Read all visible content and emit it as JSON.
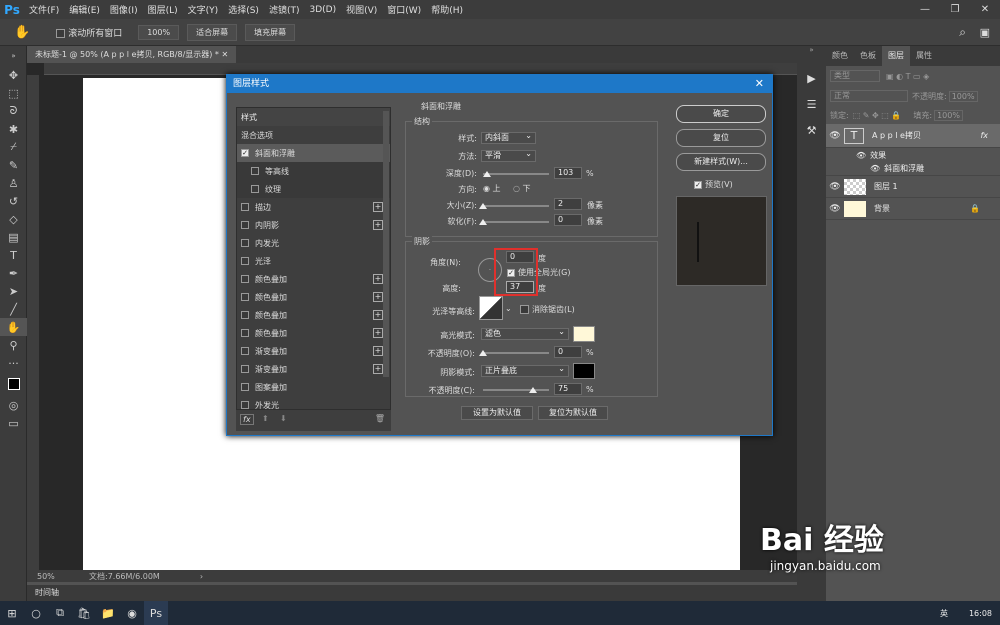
{
  "app": {
    "logo": "Ps",
    "menus": [
      "文件(F)",
      "编辑(E)",
      "图像(I)",
      "图层(L)",
      "文字(Y)",
      "选择(S)",
      "滤镜(T)",
      "3D(D)",
      "视图(V)",
      "窗口(W)",
      "帮助(H)"
    ]
  },
  "options": {
    "scroll_all": "滚动所有窗口",
    "zoom": "100%",
    "fit_screen": "适合屏幕",
    "fill_screen": "填充屏幕"
  },
  "document": {
    "tab_title": "未标题-1 @ 50% (A p p l e拷贝, RGB/8/显示器) *",
    "zoom": "50%",
    "doc_info": "文档:7.66M/6.00M",
    "timeline": "时间轴"
  },
  "layers_panel": {
    "tabs": [
      "颜色",
      "色板",
      "图层",
      "属性"
    ],
    "active_tab": "图层",
    "filter_placeholder": "类型",
    "blend_mode": "正常",
    "opacity_label": "不透明度:",
    "opacity_value": "100%",
    "lock_label": "锁定:",
    "fill_label": "填充:",
    "fill_value": "100%",
    "layers": [
      {
        "name": "A p p l e拷贝",
        "fx": "fx"
      },
      {
        "name": "效果"
      },
      {
        "name": "斜面和浮雕"
      },
      {
        "name": "图层 1"
      },
      {
        "name": "背景"
      }
    ]
  },
  "dialog": {
    "title": "图层样式",
    "styles_header": "样式",
    "blend_options": "混合选项",
    "styles": [
      {
        "label": "斜面和浮雕",
        "checked": true,
        "plus": false
      },
      {
        "label": "等高线",
        "checked": false,
        "plus": false
      },
      {
        "label": "纹理",
        "checked": false,
        "plus": false
      },
      {
        "label": "描边",
        "checked": false,
        "plus": true
      },
      {
        "label": "内阴影",
        "checked": false,
        "plus": true
      },
      {
        "label": "内发光",
        "checked": false,
        "plus": false
      },
      {
        "label": "光泽",
        "checked": false,
        "plus": false
      },
      {
        "label": "颜色叠加",
        "checked": false,
        "plus": true
      },
      {
        "label": "颜色叠加",
        "checked": false,
        "plus": true
      },
      {
        "label": "颜色叠加",
        "checked": false,
        "plus": true
      },
      {
        "label": "颜色叠加",
        "checked": false,
        "plus": true
      },
      {
        "label": "渐变叠加",
        "checked": false,
        "plus": true
      },
      {
        "label": "渐变叠加",
        "checked": false,
        "plus": true
      },
      {
        "label": "图案叠加",
        "checked": false,
        "plus": false
      },
      {
        "label": "外发光",
        "checked": false,
        "plus": false
      }
    ],
    "fx_label": "fx",
    "section_title": "斜面和浮雕",
    "structure": {
      "title": "结构",
      "style_label": "样式:",
      "style_value": "内斜面",
      "method_label": "方法:",
      "method_value": "平滑",
      "depth_label": "深度(D):",
      "depth_value": "103",
      "depth_unit": "%",
      "direction_label": "方向:",
      "dir_up": "上",
      "dir_down": "下",
      "size_label": "大小(Z):",
      "size_value": "2",
      "size_unit": "像素",
      "soften_label": "软化(F):",
      "soften_value": "0",
      "soften_unit": "像素"
    },
    "shading": {
      "title": "阴影",
      "angle_label": "角度(N):",
      "angle_value": "0",
      "angle_unit": "度",
      "global_light": "使用全局光(G)",
      "altitude_label": "高度:",
      "altitude_value": "37",
      "altitude_unit": "度",
      "gloss_label": "光泽等高线:",
      "antialias": "消除锯齿(L)",
      "highlight_label": "高光模式:",
      "highlight_value": "滤色",
      "highlight_color": "#fff8d8",
      "hl_opacity_label": "不透明度(O):",
      "hl_opacity_value": "0",
      "hl_opacity_unit": "%",
      "shadow_label": "阴影模式:",
      "shadow_value": "正片叠底",
      "shadow_color": "#000000",
      "sh_opacity_label": "不透明度(C):",
      "sh_opacity_value": "75",
      "sh_opacity_unit": "%"
    },
    "make_default": "设置为默认值",
    "reset_default": "复位为默认值",
    "ok": "确定",
    "reset": "复位",
    "new_style": "新建样式(W)...",
    "preview": "预览(V)"
  },
  "taskbar": {
    "ime": "英",
    "time": "16:08"
  },
  "watermark": {
    "brand": "Bai 经验",
    "url": "jingyan.baidu.com"
  }
}
